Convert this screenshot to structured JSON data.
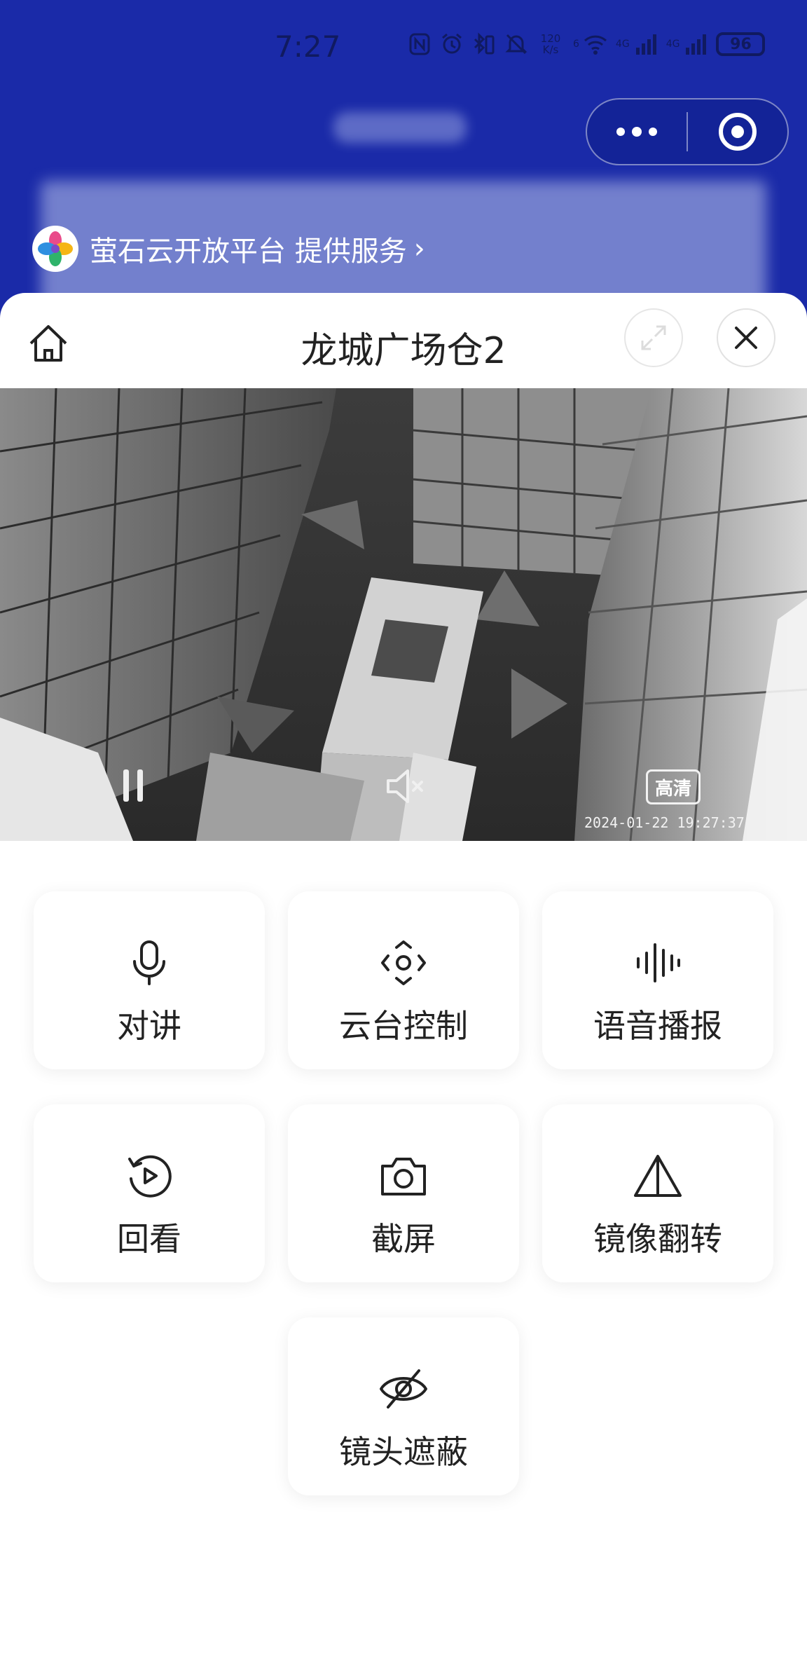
{
  "status_bar": {
    "time": "7:27",
    "net_speed_top": "120",
    "net_speed_bottom": "K/s",
    "wifi_badge": "6",
    "signal_1": "4G",
    "signal_2": "4G",
    "battery": "96"
  },
  "mini_program": {
    "provider_text": "萤石云开放平台 提供服务"
  },
  "sheet": {
    "title": "龙城广场仓2"
  },
  "video": {
    "quality_label": "高清",
    "timestamp": "2024-01-22 19:27:37"
  },
  "controls": [
    {
      "label": "对讲",
      "icon": "microphone-icon"
    },
    {
      "label": "云台控制",
      "icon": "ptz-control-icon"
    },
    {
      "label": "语音播报",
      "icon": "sound-wave-icon"
    },
    {
      "label": "回看",
      "icon": "playback-icon"
    },
    {
      "label": "截屏",
      "icon": "camera-icon"
    },
    {
      "label": "镜像翻转",
      "icon": "mirror-flip-icon"
    },
    {
      "label": "镜头遮蔽",
      "icon": "eye-off-icon"
    }
  ],
  "colors": {
    "top_background": "#1a2aa8",
    "sheet_background": "#ffffff",
    "text": "#222222"
  }
}
